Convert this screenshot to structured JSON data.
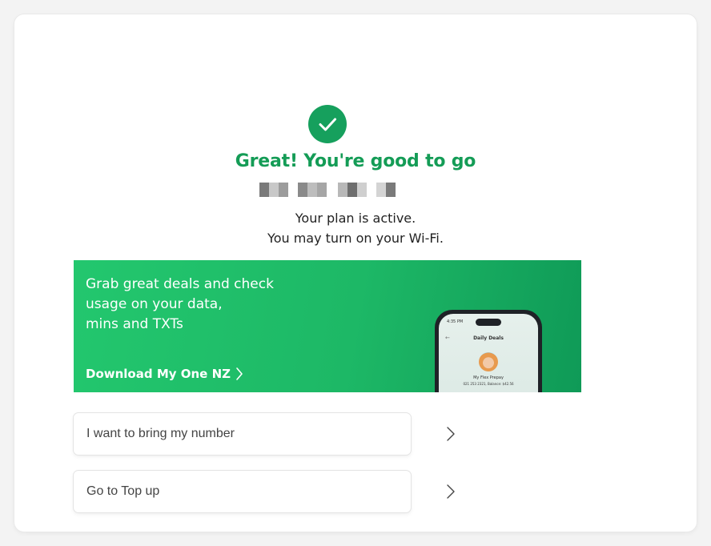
{
  "headline": "Great! You're good to go",
  "messages": {
    "line1": "Your plan is active.",
    "line2": "You may turn on your Wi-Fi."
  },
  "banner": {
    "text_line1": "Grab great deals and check",
    "text_line2": "usage on your data,",
    "text_line3": "mins and TXTs",
    "link": "Download My One NZ",
    "phone": {
      "time": "4:35 PM",
      "title": "Daily Deals",
      "plan": "My Flex Prepay",
      "detail": "021 253 2321, Balance: $42.56"
    }
  },
  "options": [
    {
      "label": "I want to bring my number",
      "icon": "chevron-right-icon"
    },
    {
      "label": "Go to Top up",
      "icon": "chevron-right-icon"
    }
  ],
  "colors": {
    "brand_green": "#149c56",
    "banner_green": "#1db866",
    "check_green": "#16a05d"
  }
}
